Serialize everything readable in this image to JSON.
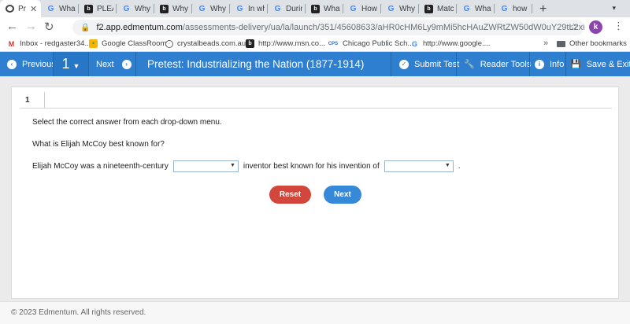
{
  "browser": {
    "tabs": [
      {
        "title": "Pr",
        "icon": "edmentum-icon",
        "active": true
      },
      {
        "title": "What",
        "icon": "google-icon"
      },
      {
        "title": "PLEA",
        "icon": "brainly-icon"
      },
      {
        "title": "Why v",
        "icon": "google-icon"
      },
      {
        "title": "Why v",
        "icon": "brainly-icon"
      },
      {
        "title": "Why v",
        "icon": "google-icon"
      },
      {
        "title": "In wh",
        "icon": "google-icon"
      },
      {
        "title": "During",
        "icon": "google-icon"
      },
      {
        "title": "What",
        "icon": "brainly-icon"
      },
      {
        "title": "How c",
        "icon": "google-icon"
      },
      {
        "title": "Why v",
        "icon": "google-icon"
      },
      {
        "title": "Match",
        "icon": "brainly-icon"
      },
      {
        "title": "What",
        "icon": "google-icon"
      },
      {
        "title": "how t",
        "icon": "google-icon"
      }
    ],
    "close_glyph": "✕",
    "new_tab_glyph": "+",
    "url_host": "f2.app.edmentum.com",
    "url_path": "/assessments-delivery/ua/la/launch/351/45608633/aHR0cHM6Ly9mMi5hcHAuZWRtZW50dW0uY29tL2xlYXJuZXItdd...",
    "profile_initial": "k",
    "bookmarks": [
      {
        "label": "Inbox - redgaster34...",
        "icon": "gmail-icon"
      },
      {
        "label": "Google ClassRoom",
        "icon": "classroom-icon"
      },
      {
        "label": "crystalbeads.com.au",
        "icon": "globe-icon"
      },
      {
        "label": "http://www.msn.co...",
        "icon": "brainly-icon"
      },
      {
        "label": "Chicago Public Sch...",
        "icon": "cps-icon"
      },
      {
        "label": "http://www.google....",
        "icon": "google-icon"
      }
    ],
    "bookmarks_more": "»",
    "other_bookmarks": "Other bookmarks"
  },
  "toolbar": {
    "previous": "Previous",
    "question_number": "1",
    "next": "Next",
    "title": "Pretest: Industrializing the Nation (1877-1914)",
    "submit": "Submit Test",
    "reader_tools": "Reader Tools",
    "info": "Info",
    "save_exit": "Save & Exit",
    "accent_color": "#2f7fd0"
  },
  "question": {
    "tab_number": "1",
    "instruction": "Select the correct answer from each drop-down menu.",
    "prompt": "What is Elijah McCoy best known for?",
    "sentence_part1": "Elijah McCoy was a nineteenth-century",
    "sentence_part2": "inventor best known for his invention of",
    "sentence_end": ".",
    "dropdown1_value": "",
    "dropdown2_value": "",
    "reset": "Reset",
    "next": "Next",
    "reset_color": "#d2473c",
    "next_color": "#3688d8"
  },
  "footer": {
    "copyright": "© 2023 Edmentum. All rights reserved."
  }
}
